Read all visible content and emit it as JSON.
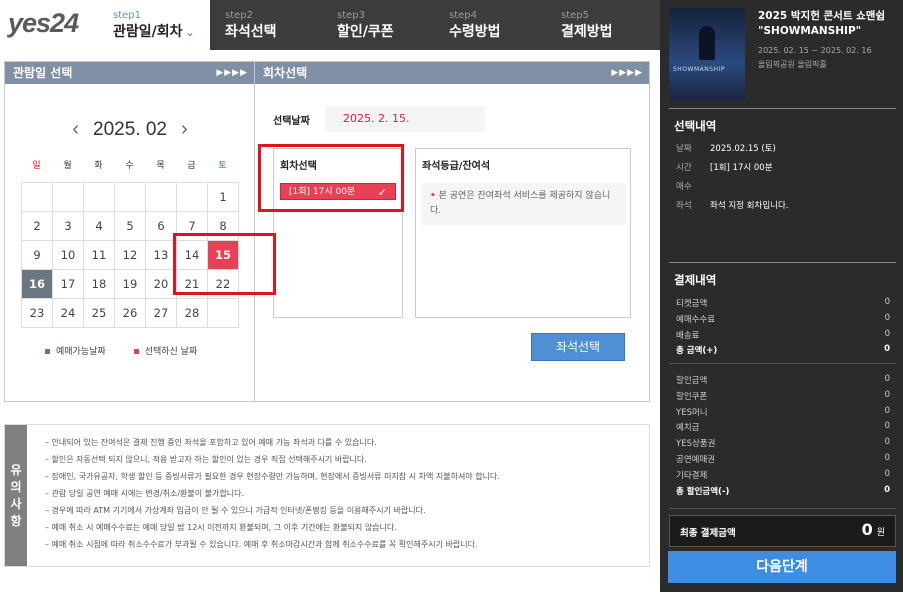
{
  "logo": {
    "text": "yes24"
  },
  "steps": [
    {
      "num": "step1",
      "label": "관람일/회차"
    },
    {
      "num": "step2",
      "label": "좌석선택"
    },
    {
      "num": "step3",
      "label": "할인/쿠폰"
    },
    {
      "num": "step4",
      "label": "수령방법"
    },
    {
      "num": "step5",
      "label": "결제방법"
    }
  ],
  "datePanel": {
    "title": "관람일 선택",
    "arrows": "▶▶▶▶",
    "month": "2025. 02",
    "dow": [
      "일",
      "월",
      "화",
      "수",
      "목",
      "금",
      "토"
    ],
    "weeks": [
      [
        "",
        "",
        "",
        "",
        "",
        "",
        "1"
      ],
      [
        "2",
        "3",
        "4",
        "5",
        "6",
        "7",
        "8"
      ],
      [
        "9",
        "10",
        "11",
        "12",
        "13",
        "14",
        "15"
      ],
      [
        "16",
        "17",
        "18",
        "19",
        "20",
        "21",
        "22"
      ],
      [
        "23",
        "24",
        "25",
        "26",
        "27",
        "28",
        ""
      ]
    ],
    "selected": "15",
    "highlighted": "16",
    "legend": {
      "available": "예매가능날짜",
      "selected": "선택하신 날짜"
    },
    "colors": {
      "available": "#6b7680",
      "selected": "#e84055"
    }
  },
  "timePanel": {
    "title": "회차선택",
    "arrows": "▶▶▶▶",
    "selDateLabel": "선택날짜",
    "selDateValue": "2025. 2. 15.",
    "roundLabel": "회차선택",
    "roundValue": "[1회] 17시 00분",
    "seatLabel": "좌석등급/잔여석",
    "seatNote": "본 공연은 잔여좌석 서비스를 제공하지 않습니다.",
    "seatButton": "좌석선택"
  },
  "notice": {
    "side": [
      "유",
      "의",
      "사",
      "항"
    ],
    "items": [
      "– 안내되어 있는 잔여석은 결제 진행 중인 좌석을 포함하고 있어 예매 가능 좌석과 다를 수 있습니다.",
      "– 할인은 자동선택 되지 않으니, 적용 받고자 하는 할인이 있는 경우 직접 선택해주시기 바랍니다.",
      "– 장애인, 국가유공자, 학생 할인 등 증빙서류가 필요한 경우 현장수령만 가능하며, 현장에서 증빙서류 미지참 시 차액 지불하셔야 합니다.",
      "– 관람 당일 공연 예매 시에는 변경/취소/환불이 불가합니다.",
      "– 경우에 따라 ATM 기기에서 가상계좌 입금이 안 될 수 있으니 가급적 인터넷/폰뱅킹 등을 이용해주시기 바랍니다.",
      "– 예매 취소 시 예매수수료는 예매 당일 밤 12시 이전까지 환불되며, 그 이후 기간에는 환불되지 않습니다.",
      "– 예매 취소 시점에 따라 취소수수료가 부과될 수 있습니다. 예매 후 취소마감시간과 함께 취소수수료를 꼭 확인해주시기 바랍니다."
    ]
  },
  "sidebar": {
    "poster_text": "SHOWMANSHIP",
    "title": "2025 박지헌 콘서트 쇼맨쉽 \"SHOWMANSHIP\"",
    "period": "2025. 02. 15 ~ 2025. 02. 16",
    "venue": "올림픽공원 올림픽홀",
    "infoHead": "선택내역",
    "info": [
      {
        "k": "날짜",
        "v": "2025.02.15 (토)"
      },
      {
        "k": "시간",
        "v": "[1회] 17시 00분"
      },
      {
        "k": "매수",
        "v": ""
      },
      {
        "k": "좌석",
        "v": "좌석 지정 회차입니다."
      }
    ],
    "payHead": "결제내역",
    "pay1": [
      {
        "k": "티켓금액",
        "v": "0"
      },
      {
        "k": "예매수수료",
        "v": "0"
      },
      {
        "k": "배송료",
        "v": "0"
      },
      {
        "k": "총 금액(+)",
        "v": "0"
      }
    ],
    "pay2": [
      {
        "k": "할인금액",
        "v": "0"
      },
      {
        "k": "할인쿠폰",
        "v": "0"
      },
      {
        "k": "YES머니",
        "v": "0"
      },
      {
        "k": "예치금",
        "v": "0"
      },
      {
        "k": "YES상품권",
        "v": "0"
      },
      {
        "k": "공연예매권",
        "v": "0"
      },
      {
        "k": "기타결제",
        "v": "0"
      },
      {
        "k": "총 할인금액(-)",
        "v": "0"
      }
    ],
    "finalLabel": "최종 결제금액",
    "finalValue": "0",
    "finalUnit": "원",
    "nextButton": "다음단계"
  }
}
